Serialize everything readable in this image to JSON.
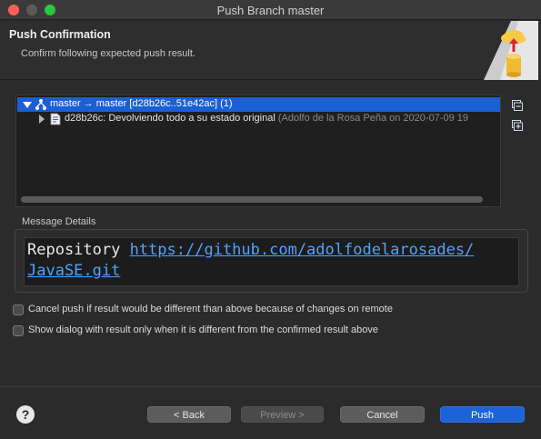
{
  "window": {
    "title": "Push Branch master"
  },
  "header": {
    "title": "Push Confirmation",
    "subtitle": "Confirm following expected push result."
  },
  "tree": {
    "rows": [
      {
        "label": "master → master [d28b26c..51e42ac] (1)",
        "detail": ""
      },
      {
        "label": "d28b26c: Devolviendo todo a su estado original",
        "detail": " (Adolfo de la Rosa Peña on 2020-07-09 19"
      }
    ]
  },
  "message_details": {
    "label": "Message Details",
    "prefix": "Repository ",
    "link_line1": "https://github.com/adolfodelarosades/",
    "link_line2": "JavaSE.git"
  },
  "options": {
    "cancel_push": "Cancel push if result would be different than above because of changes on remote",
    "show_dialog": "Show dialog with result only when it is different from the confirmed result above"
  },
  "buttons": {
    "help": "?",
    "back": "< Back",
    "preview": "Preview >",
    "cancel": "Cancel",
    "push": "Push"
  },
  "colors": {
    "selection": "#1a5fd6",
    "link": "#4ea3ff",
    "primary": "#1c62d8"
  }
}
